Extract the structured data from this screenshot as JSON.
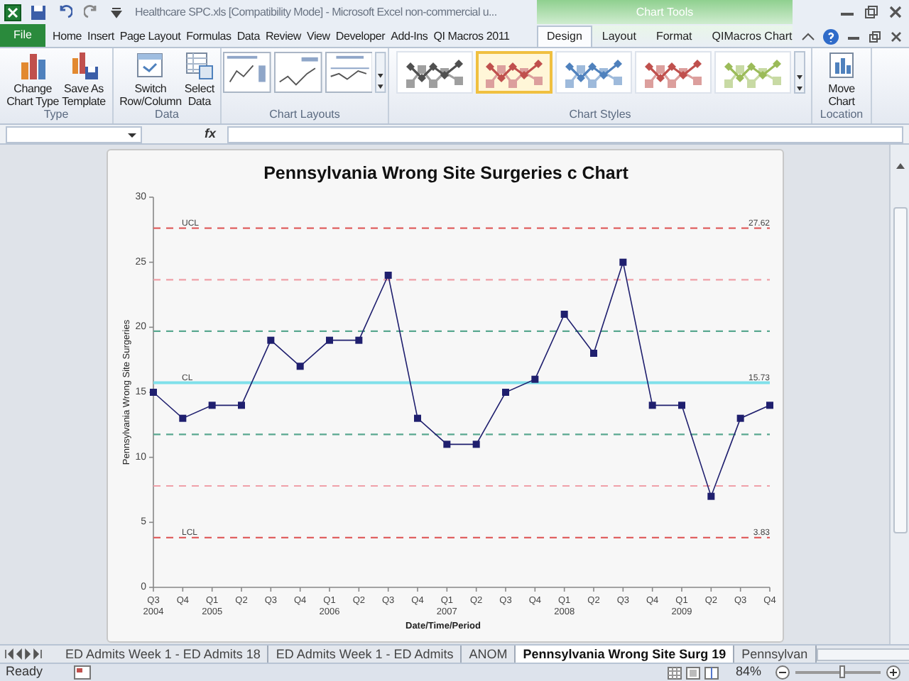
{
  "window": {
    "title": "Healthcare SPC.xls  [Compatibility Mode] - Microsoft Excel non-commercial u...",
    "context_group": "Chart Tools"
  },
  "tabs": [
    {
      "label": "File",
      "selected": false,
      "kind": "file"
    },
    {
      "label": "Home",
      "selected": false,
      "kind": "tab"
    },
    {
      "label": "Insert",
      "selected": false,
      "kind": "tab"
    },
    {
      "label": "Page Layout",
      "selected": false,
      "kind": "tab"
    },
    {
      "label": "Formulas",
      "selected": false,
      "kind": "tab"
    },
    {
      "label": "Data",
      "selected": false,
      "kind": "tab"
    },
    {
      "label": "Review",
      "selected": false,
      "kind": "tab"
    },
    {
      "label": "View",
      "selected": false,
      "kind": "tab"
    },
    {
      "label": "Developer",
      "selected": false,
      "kind": "tab"
    },
    {
      "label": "Add-Ins",
      "selected": false,
      "kind": "tab"
    },
    {
      "label": "QI Macros 2011",
      "selected": false,
      "kind": "tab"
    },
    {
      "label": "Design",
      "selected": true,
      "kind": "context"
    },
    {
      "label": "Layout",
      "selected": false,
      "kind": "context"
    },
    {
      "label": "Format",
      "selected": false,
      "kind": "context"
    },
    {
      "label": "QIMacros Chart",
      "selected": false,
      "kind": "context"
    }
  ],
  "ribbon": {
    "type_group": {
      "label": "Type",
      "buttons": [
        "Change\nChart Type",
        "Save As\nTemplate"
      ]
    },
    "data_group": {
      "label": "Data",
      "buttons": [
        "Switch\nRow/Column",
        "Select\nData"
      ]
    },
    "layouts_group": {
      "label": "Chart Layouts"
    },
    "styles_group": {
      "label": "Chart Styles",
      "styles": [
        {
          "color": "#505050",
          "selected": false
        },
        {
          "color": "#c0504d",
          "selected": true
        },
        {
          "color": "#4f81bd",
          "selected": false
        },
        {
          "color": "#c0504d",
          "selected": false
        },
        {
          "color": "#9bbb59",
          "selected": false
        }
      ]
    },
    "location_group": {
      "label": "Location",
      "button": "Move\nChart"
    }
  },
  "formula_bar": {
    "fx": "fx"
  },
  "chart": {
    "chart_data": {
      "type": "line",
      "title": "Pennsylvania Wrong Site Surgeries c Chart",
      "xlabel": "Date/Time/Period",
      "ylabel": "Pennsylvania Wrong Site Surgeries",
      "categories": [
        "Q3 2004",
        "Q4",
        "Q1 2005",
        "Q2",
        "Q3",
        "Q4",
        "Q1 2006",
        "Q2",
        "Q3",
        "Q4",
        "Q1 2007",
        "Q2",
        "Q3",
        "Q4",
        "Q1 2008",
        "Q2",
        "Q3",
        "Q4",
        "Q1 2009",
        "Q2",
        "Q3",
        "Q4"
      ],
      "series": [
        {
          "color": "#1f1f6e",
          "marker": "square",
          "values": [
            15,
            13,
            14,
            14,
            19,
            17,
            19,
            19,
            24,
            13,
            11,
            11,
            15,
            16,
            21,
            18,
            25,
            14,
            14,
            7,
            13,
            14
          ]
        }
      ],
      "ylim": [
        0,
        30
      ],
      "yticks": [
        0,
        5,
        10,
        15,
        20,
        25,
        30
      ],
      "ref_lines": [
        {
          "axis": "y",
          "value": 27.62,
          "label": "UCL",
          "color": "#e06060"
        },
        {
          "axis": "y",
          "value": 23.65,
          "color": "#f0a0a8"
        },
        {
          "axis": "y",
          "value": 19.7,
          "color": "#5aa890"
        },
        {
          "axis": "y",
          "value": 15.73,
          "label": "CL",
          "color": "#7fe0ea"
        },
        {
          "axis": "y",
          "value": 11.76,
          "color": "#5aa890"
        },
        {
          "axis": "y",
          "value": 7.8,
          "color": "#f0a0a8"
        },
        {
          "axis": "y",
          "value": 3.83,
          "label": "LCL",
          "color": "#e06060"
        }
      ],
      "annotations": [
        {
          "text": "27.62"
        },
        {
          "text": "15.73"
        },
        {
          "text": "3.83"
        }
      ]
    }
  },
  "sheet_tabs": [
    {
      "label": "ED Admits Week 1 - ED Admits 18",
      "selected": false
    },
    {
      "label": "ED Admits Week 1 - ED Admits",
      "selected": false
    },
    {
      "label": "ANOM",
      "selected": false
    },
    {
      "label": "Pennsylvania Wrong Site Surg 19",
      "selected": true
    },
    {
      "label": "Pennsylvan",
      "selected": false
    }
  ],
  "status_bar": {
    "status": "Ready",
    "zoom": "84%",
    "zoom_slider": {
      "level": 0.55
    }
  }
}
